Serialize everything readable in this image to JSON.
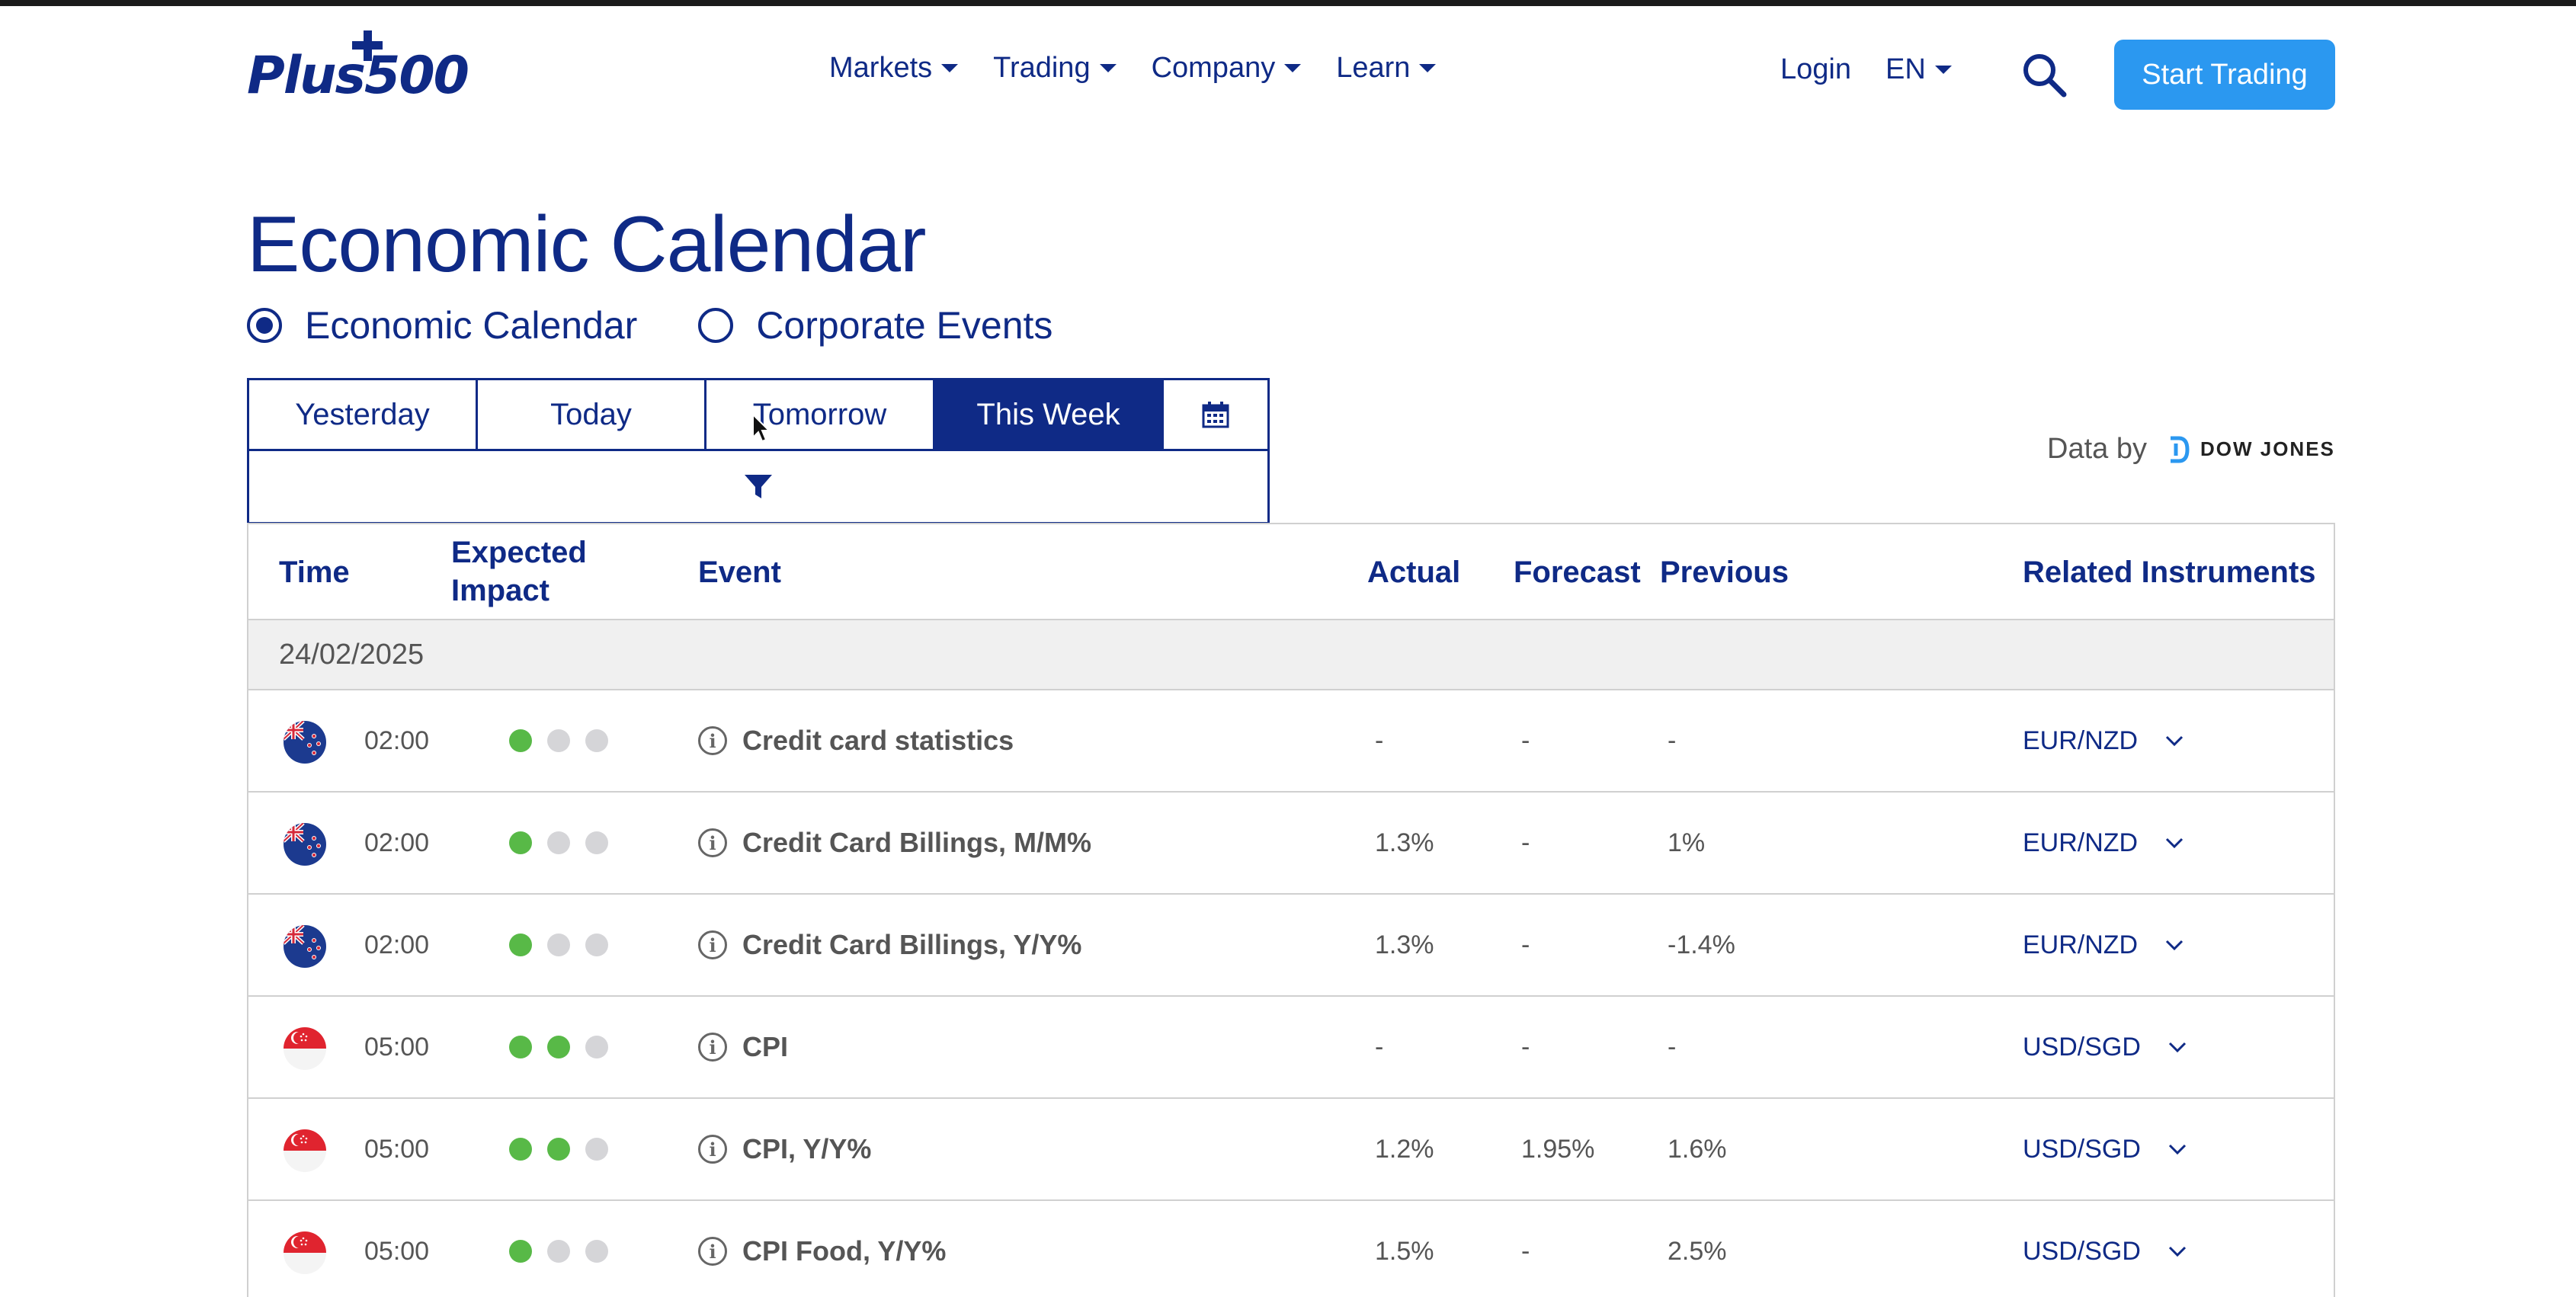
{
  "header": {
    "logo": "Plus500",
    "nav": [
      {
        "label": "Markets"
      },
      {
        "label": "Trading"
      },
      {
        "label": "Company"
      },
      {
        "label": "Learn"
      }
    ],
    "login": "Login",
    "lang": "EN",
    "cta": "Start Trading"
  },
  "page": {
    "title": "Economic Calendar",
    "radios": [
      {
        "label": "Economic Calendar",
        "checked": true
      },
      {
        "label": "Corporate Events",
        "checked": false
      }
    ],
    "tabs": [
      {
        "label": "Yesterday"
      },
      {
        "label": "Today"
      },
      {
        "label": "Tomorrow"
      },
      {
        "label": "This Week",
        "active": true
      }
    ],
    "data_by": "Data by",
    "provider": "DOW JONES"
  },
  "table": {
    "headers": {
      "time": "Time",
      "impact_1": "Expected",
      "impact_2": "Impact",
      "event": "Event",
      "actual": "Actual",
      "forecast": "Forecast",
      "previous": "Previous",
      "related": "Related Instruments"
    },
    "date": "24/02/2025",
    "rows": [
      {
        "flag": "new-zealand",
        "time": "02:00",
        "impact": 1,
        "event": "Credit card statistics",
        "actual": "-",
        "forecast": "-",
        "previous": "-",
        "instrument": "EUR/NZD"
      },
      {
        "flag": "new-zealand",
        "time": "02:00",
        "impact": 1,
        "event": "Credit Card Billings, M/M%",
        "actual": "1.3%",
        "forecast": "-",
        "previous": "1%",
        "instrument": "EUR/NZD"
      },
      {
        "flag": "new-zealand",
        "time": "02:00",
        "impact": 1,
        "event": "Credit Card Billings, Y/Y%",
        "actual": "1.3%",
        "forecast": "-",
        "previous": "-1.4%",
        "instrument": "EUR/NZD"
      },
      {
        "flag": "singapore",
        "time": "05:00",
        "impact": 2,
        "event": "CPI",
        "actual": "-",
        "forecast": "-",
        "previous": "-",
        "instrument": "USD/SGD"
      },
      {
        "flag": "singapore",
        "time": "05:00",
        "impact": 2,
        "event": "CPI, Y/Y%",
        "actual": "1.2%",
        "forecast": "1.95%",
        "previous": "1.6%",
        "instrument": "USD/SGD"
      },
      {
        "flag": "singapore",
        "time": "05:00",
        "impact": 1,
        "event": "CPI Food, Y/Y%",
        "actual": "1.5%",
        "forecast": "-",
        "previous": "2.5%",
        "instrument": "USD/SGD"
      }
    ]
  },
  "colors": {
    "brand": "#0f2a86",
    "cta": "#2b98f0",
    "impact_on": "#58b947",
    "impact_off": "#d5d5d8"
  }
}
